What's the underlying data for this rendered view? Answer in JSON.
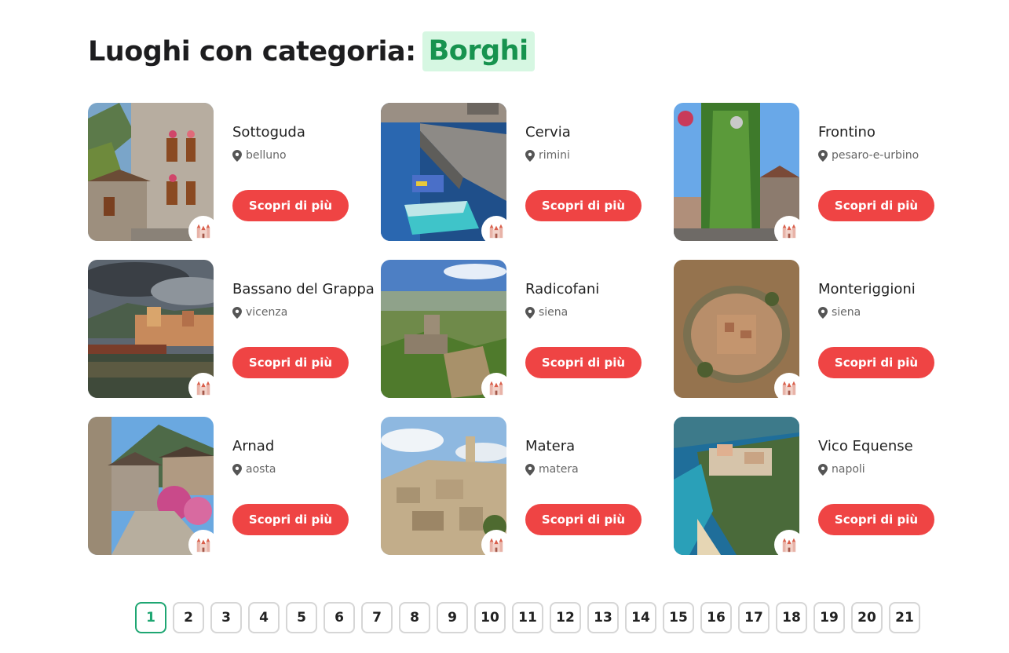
{
  "heading": {
    "prefix": "Luoghi con categoria:",
    "category": "Borghi"
  },
  "cta_label": "Scopri di più",
  "icons": {
    "location": "map-pin-icon",
    "category": "castle-icon"
  },
  "colors": {
    "accent_red": "#ef4444",
    "category_green": "#17934f",
    "category_bg": "#d6f7e2",
    "active_page": "#1ea672"
  },
  "places": [
    {
      "name": "Sottoguda",
      "location": "belluno"
    },
    {
      "name": "Cervia",
      "location": "rimini"
    },
    {
      "name": "Frontino",
      "location": "pesaro-e-urbino"
    },
    {
      "name": "Bassano del Grappa",
      "location": "vicenza"
    },
    {
      "name": "Radicofani",
      "location": "siena"
    },
    {
      "name": "Monteriggioni",
      "location": "siena"
    },
    {
      "name": "Arnad",
      "location": "aosta"
    },
    {
      "name": "Matera",
      "location": "matera"
    },
    {
      "name": "Vico Equense",
      "location": "napoli"
    }
  ],
  "pagination": {
    "current": "1",
    "pages": [
      "1",
      "2",
      "3",
      "4",
      "5",
      "6",
      "7",
      "8",
      "9",
      "10",
      "11",
      "12",
      "13",
      "14",
      "15",
      "16",
      "17",
      "18",
      "19",
      "20",
      "21"
    ]
  }
}
